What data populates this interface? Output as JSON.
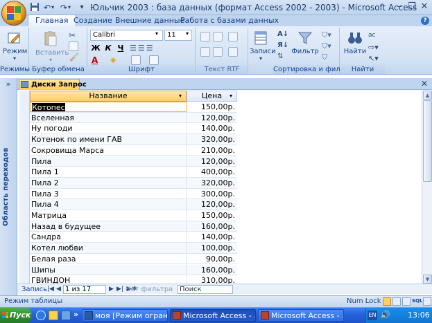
{
  "window": {
    "title": "Юльчик 2003 : база данных (формат Access 2002 - 2003) - Microsoft Access",
    "colors": {
      "accent": "#15428b",
      "selected_tab": "#ffce5a",
      "taskbar": "#2763d9"
    }
  },
  "ribbon_tabs": [
    {
      "label": "Главная",
      "active": true
    },
    {
      "label": "Создание",
      "active": false
    },
    {
      "label": "Внешние данные",
      "active": false
    },
    {
      "label": "Работа с базами данных",
      "active": false
    }
  ],
  "ribbon": {
    "mode_label": "Режим",
    "paste_label": "Вставить",
    "font_name": "Calibri",
    "font_size": "11",
    "bold": "Ж",
    "italic": "К",
    "underline": "Ч",
    "records_label": "Записи",
    "filter_label": "Фильтр",
    "find_label": "Найти",
    "groups": [
      "Режимы",
      "Буфер обмена",
      "Шрифт",
      "Текст RTF",
      "Сортировка и фильтр",
      "Найти"
    ]
  },
  "nav_pane": {
    "label": "Область переходов",
    "toggle": "»"
  },
  "doc_tab": {
    "label": "Диски Запрос"
  },
  "table": {
    "headers": [
      "Название",
      "Цена"
    ],
    "rows": [
      {
        "name": "Котопес",
        "price": "150,00р."
      },
      {
        "name": "Вселенная",
        "price": "120,00р."
      },
      {
        "name": "Ну погоди",
        "price": "140,00р."
      },
      {
        "name": "Котенок по имени ГАВ",
        "price": "320,00р."
      },
      {
        "name": "Сокровища Марса",
        "price": "210,00р."
      },
      {
        "name": "Пила",
        "price": "120,00р."
      },
      {
        "name": "Пила 1",
        "price": "400,00р."
      },
      {
        "name": "Пила 2",
        "price": "320,00р."
      },
      {
        "name": "Пила 3",
        "price": "300,00р."
      },
      {
        "name": "Пила 4",
        "price": "120,00р."
      },
      {
        "name": "Матрица",
        "price": "150,00р."
      },
      {
        "name": "Назад в будущее",
        "price": "160,00р."
      },
      {
        "name": "Сандра",
        "price": "140,00р."
      },
      {
        "name": "Котел любви",
        "price": "100,00р."
      },
      {
        "name": "Белая раза",
        "price": "90,00р."
      },
      {
        "name": "Шипы",
        "price": "160,00р."
      },
      {
        "name": "ГВИНДОН",
        "price": "310,00р."
      }
    ]
  },
  "record_nav": {
    "label": "Запись:",
    "position": "1 из 17",
    "filter": "Нет фильтра",
    "search": "Поиск"
  },
  "status_bar": {
    "mode": "Режим таблицы",
    "num_lock": "Num Lock"
  },
  "taskbar": {
    "start": "Пуск",
    "buttons": [
      "моя [Режим ограни...",
      "Microsoft Access - ...",
      "Microsoft Access - ..."
    ],
    "lang": "EN",
    "time": "13:06"
  }
}
